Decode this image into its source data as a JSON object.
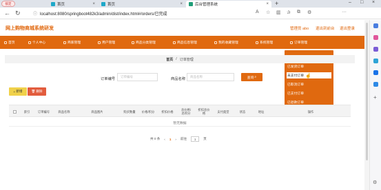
{
  "browser": {
    "profile_label": "锁定",
    "tabs": [
      {
        "label": "首页",
        "active": false
      },
      {
        "label": "首页",
        "active": false
      },
      {
        "label": "后台管理系统",
        "active": true
      }
    ],
    "url": "localhost:8080/springboot482k3/admin/dist/index.html#/orders/已完成",
    "new_tab": "+"
  },
  "header": {
    "title": "网上购物商城系统研发",
    "user": "管理员 abo",
    "exit_to_front": "退出到前台",
    "logout": "退出登录"
  },
  "menu": {
    "items": [
      "首页",
      "个人中心",
      "商家管理",
      "用户管理",
      "商品分类管理",
      "商品信息管理",
      "我的收藏管理",
      "系统管理",
      "订单管理"
    ]
  },
  "dropdown": {
    "items": [
      "已完成订单",
      "已发货订单",
      "未支付订单",
      "已取消订单",
      "已支付订单",
      "已退款订单"
    ],
    "hovered_index": 2
  },
  "breadcrumb": {
    "home": "首页",
    "sep": "/",
    "current": "订单管理"
  },
  "search": {
    "order_no_label": "订单编号",
    "order_no_placeholder": "订单编号",
    "goods_name_label": "商品名称",
    "goods_name_placeholder": "商品名称",
    "search_button": "查询"
  },
  "actions": {
    "add": "新增",
    "delete": "删除"
  },
  "table": {
    "headers": [
      "索引",
      "订单编号",
      "商品名称",
      "商品图片",
      "购买数量",
      "价格/积分",
      "折扣价格",
      "总价格/总积分",
      "折扣总价格",
      "支付类型",
      "状态",
      "地址",
      "操作"
    ],
    "empty_text": "暂无数据"
  },
  "pagination": {
    "total": "共 0 条",
    "prev": "‹",
    "page": "1",
    "next": "›",
    "goto_label": "前往",
    "goto_value": "1",
    "page_unit": "页"
  },
  "colors": {
    "accent": "#e0690f",
    "add_button": "#f0d14a",
    "delete_button": "#e25c3d"
  }
}
